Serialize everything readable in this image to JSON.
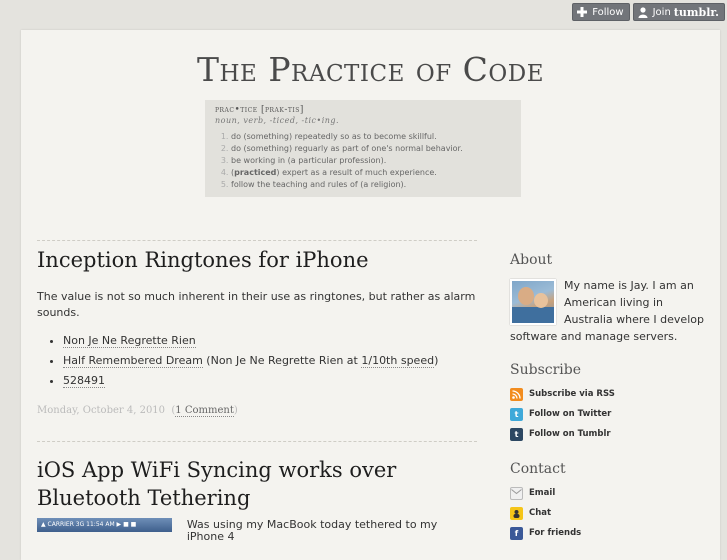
{
  "tumblr_controls": {
    "follow_label": "Follow",
    "join_label": "Join",
    "join_brand": "tumblr."
  },
  "header": {
    "title": "The Practice of Code",
    "definition": {
      "word": "prac•tice [prak-tis]",
      "pos": "noun, verb, -ticed, -tic•ing.",
      "meanings": [
        "do (something) repeatedly so as to become skillful.",
        "do (something) reguarly as part of one's normal behavior.",
        "be working in (a particular profession).",
        "(practiced) expert as a result of much experience.",
        "follow the teaching and rules of (a religion)."
      ],
      "meaning4_bold": "practiced",
      "meaning4_rest": " expert as a result of much experience."
    }
  },
  "posts": [
    {
      "title": "Inception Ringtones for iPhone",
      "intro": "The value is not so much inherent in their use as ringtones, but rather as alarm sounds.",
      "items": {
        "item1": "Non Je Ne Regrette Rien",
        "item2_link": "Half Remembered Dream",
        "item2_mid": " (Non Je Ne Regrette Rien at ",
        "item2_link2": "1/10th speed",
        "item2_end": ")",
        "item3": "528491"
      },
      "date": "Monday, October 4, 2010",
      "comments": "1 Comment"
    },
    {
      "title": "iOS App WiFi Syncing works over Bluetooth Tethering",
      "excerpt": "Was using my MacBook today tethered to my iPhone 4",
      "thumb_text": "▲ CARRIER  3G    11:54 AM    ▶ ■ ■"
    }
  ],
  "sidebar": {
    "about_heading": "About",
    "about_text": "My name is Jay. I am an American living in Australia where I develop software and manage servers.",
    "subscribe_heading": "Subscribe",
    "subscribe_links": [
      "Subscribe via RSS",
      "Follow on Twitter",
      "Follow on Tumblr"
    ],
    "contact_heading": "Contact",
    "contact_links": [
      "Email",
      "Chat",
      "For friends"
    ]
  },
  "colors": {
    "background": "#e4e3de",
    "page": "#f4f3ef",
    "rss": "#f28c1e",
    "twitter": "#3fa9d9",
    "tumblr": "#2c4762",
    "facebook": "#3b5998"
  }
}
